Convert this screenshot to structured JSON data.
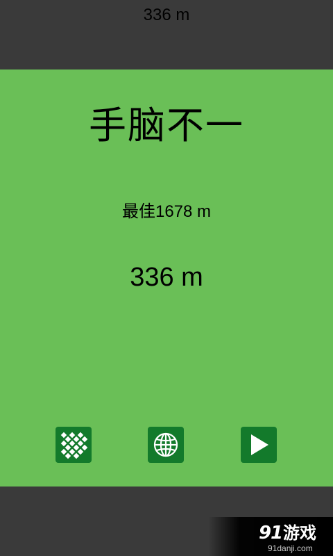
{
  "hud": {
    "distance": "336 m"
  },
  "menu": {
    "title": "手脑不一",
    "best": "最佳1678 m",
    "score": "336 m"
  },
  "buttons": [
    {
      "name": "levels-grid-button",
      "icon": "grid-icon"
    },
    {
      "name": "online-globe-button",
      "icon": "globe-icon"
    },
    {
      "name": "play-button",
      "icon": "play-icon"
    }
  ],
  "colors": {
    "panel": "#6abf57",
    "button": "#137a2b",
    "frame": "#3a3a3a"
  },
  "watermark": {
    "brand": "91游戏",
    "url": "91danji.com"
  }
}
